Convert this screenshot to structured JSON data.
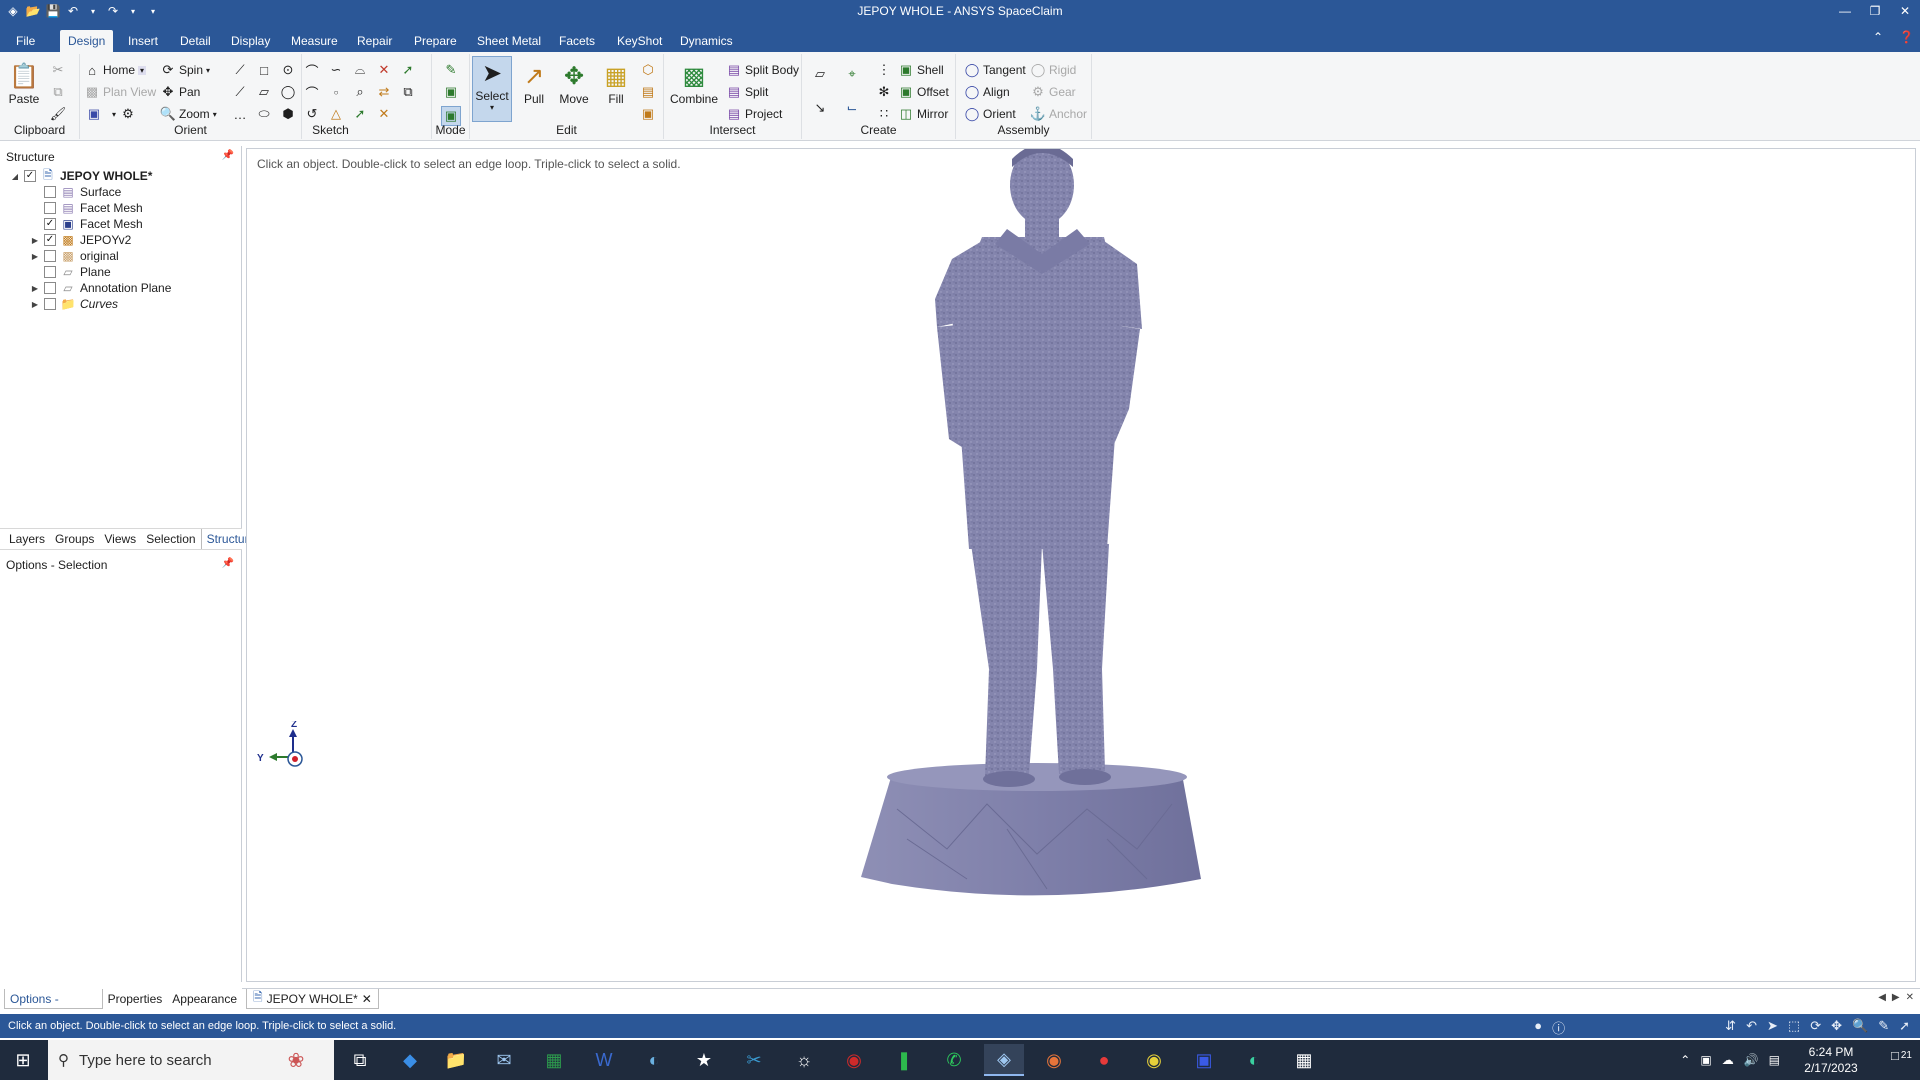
{
  "window": {
    "title": "JEPOY WHOLE - ANSYS SpaceClaim"
  },
  "menu": {
    "tabs": [
      "File",
      "Design",
      "Insert",
      "Detail",
      "Display",
      "Measure",
      "Repair",
      "Prepare",
      "Sheet Metal",
      "Facets",
      "KeyShot",
      "Dynamics"
    ],
    "active": "Design"
  },
  "ribbon": {
    "clipboard": {
      "paste": "Paste",
      "label": "Clipboard"
    },
    "orient": {
      "home": "Home",
      "plan_view": "Plan View",
      "spin": "Spin",
      "pan": "Pan",
      "zoom": "Zoom",
      "label": "Orient"
    },
    "sketch": {
      "label": "Sketch"
    },
    "mode": {
      "label": "Mode"
    },
    "edit": {
      "select": "Select",
      "pull": "Pull",
      "move": "Move",
      "fill": "Fill",
      "label": "Edit"
    },
    "intersect": {
      "combine": "Combine",
      "split_body": "Split Body",
      "split": "Split",
      "project": "Project",
      "label": "Intersect"
    },
    "create": {
      "shell": "Shell",
      "offset": "Offset",
      "mirror": "Mirror",
      "label": "Create"
    },
    "assembly": {
      "tangent": "Tangent",
      "align": "Align",
      "orient": "Orient",
      "rigid": "Rigid",
      "gear": "Gear",
      "anchor": "Anchor",
      "label": "Assembly"
    }
  },
  "structure": {
    "header": "Structure",
    "root": "JEPOY WHOLE*",
    "items": [
      {
        "label": "Surface",
        "checked": false,
        "expandable": false
      },
      {
        "label": "Facet Mesh",
        "checked": false,
        "expandable": false
      },
      {
        "label": "Facet Mesh",
        "checked": true,
        "expandable": false
      },
      {
        "label": "JEPOYv2",
        "checked": true,
        "expandable": true
      },
      {
        "label": "original",
        "checked": false,
        "expandable": true
      },
      {
        "label": "Plane",
        "checked": false,
        "expandable": false
      },
      {
        "label": "Annotation Plane",
        "checked": false,
        "expandable": true
      },
      {
        "label": "Curves",
        "checked": false,
        "expandable": true
      }
    ]
  },
  "panel_tabs": [
    "Layers",
    "Groups",
    "Views",
    "Selection",
    "Structure"
  ],
  "panel_tabs_active": "Structure",
  "options": {
    "header": "Options - Selection"
  },
  "bottom_tabs": [
    "Options - Selection",
    "Properties",
    "Appearance"
  ],
  "bottom_tabs_active": "Options - Selection",
  "viewport": {
    "hint": "Click an object. Double-click to select an edge loop. Triple-click to select a solid.",
    "triad": {
      "z": "Z",
      "y": "Y"
    }
  },
  "doc_tab": {
    "label": "JEPOY WHOLE*"
  },
  "status": {
    "message": "Click an object. Double-click to select an edge loop. Triple-click to select a solid."
  },
  "taskbar": {
    "search_placeholder": "Type here to search",
    "time": "6:24 PM",
    "date": "2/17/2023",
    "notification_count": "21"
  },
  "colors": {
    "titlebar": "#2b5797",
    "model": "#7f80aa",
    "taskbar": "#1f2b3d"
  }
}
